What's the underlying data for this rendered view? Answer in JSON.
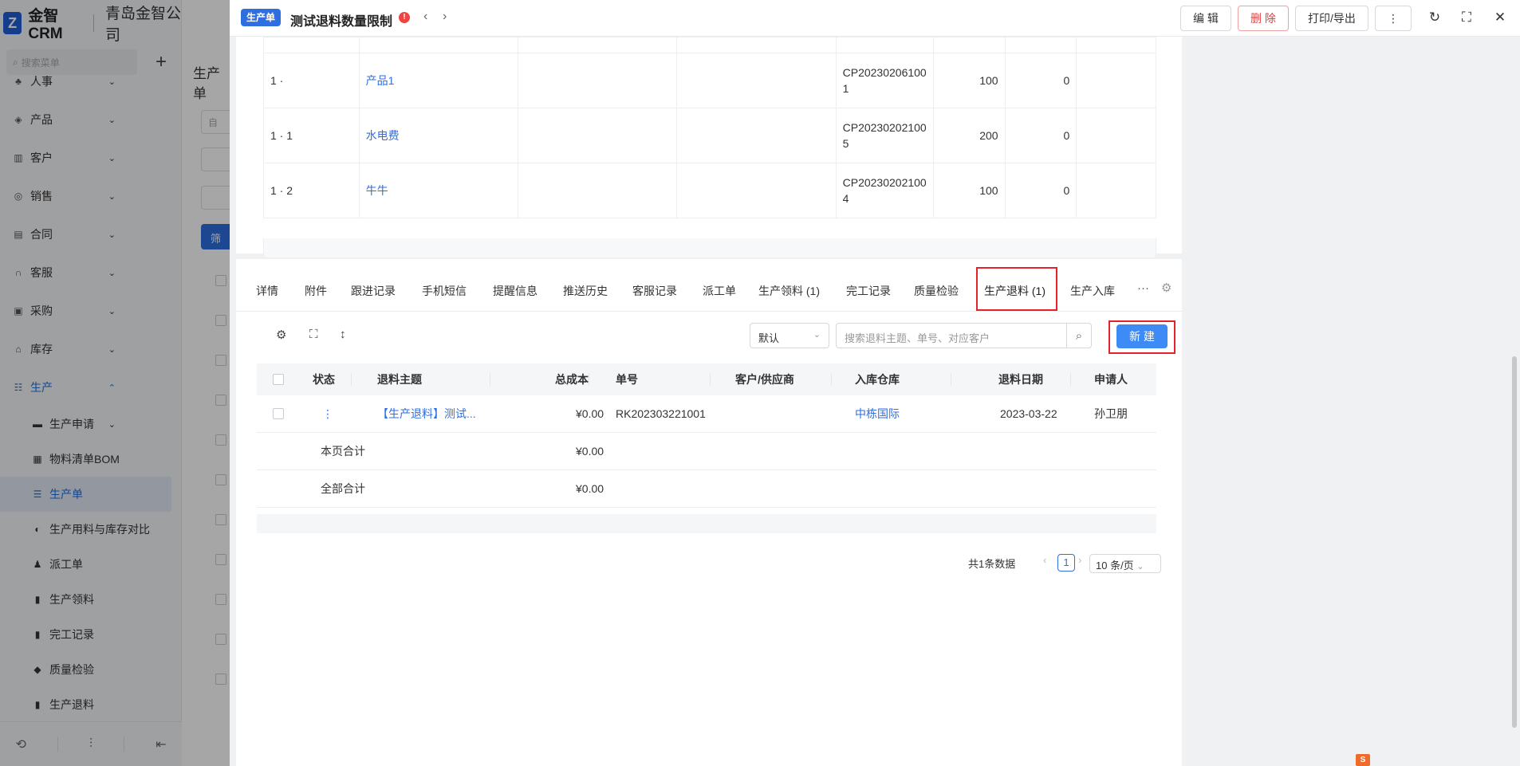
{
  "sidebar": {
    "logo_text": "金智CRM",
    "company": "青岛金智公司",
    "search_placeholder": "搜索菜单",
    "menu": [
      {
        "label": "人事",
        "icon": "users-icon"
      },
      {
        "label": "产品",
        "icon": "cube-icon"
      },
      {
        "label": "客户",
        "icon": "chart-icon"
      },
      {
        "label": "销售",
        "icon": "target-icon"
      },
      {
        "label": "合同",
        "icon": "document-icon"
      },
      {
        "label": "客服",
        "icon": "headset-icon"
      },
      {
        "label": "采购",
        "icon": "cart-icon"
      },
      {
        "label": "库存",
        "icon": "warehouse-icon"
      },
      {
        "label": "生产",
        "icon": "factory-icon"
      }
    ],
    "submenu": [
      {
        "label": "生产申请"
      },
      {
        "label": "物料清单BOM"
      },
      {
        "label": "生产单"
      },
      {
        "label": "生产用料与库存对比"
      },
      {
        "label": "派工单"
      },
      {
        "label": "生产领料"
      },
      {
        "label": "完工记录"
      },
      {
        "label": "质量检验"
      },
      {
        "label": "生产退料"
      }
    ]
  },
  "background": {
    "page_title": "生产单",
    "search_stub": "自",
    "filter_label": "筛"
  },
  "header": {
    "tag": "生产单",
    "title": "测试退料数量限制",
    "warn": "!",
    "buttons": {
      "edit": "编 辑",
      "delete": "删 除",
      "print": "打印/导出",
      "more": "⋮"
    }
  },
  "top_table": {
    "rows": [
      {
        "idx": "1 ·",
        "name": "产品1",
        "code_a": "CP20230206100",
        "code_b": "1",
        "qty": "100",
        "done": "0"
      },
      {
        "idx": "1 · 1",
        "name": "水电费",
        "code_a": "CP20230202100",
        "code_b": "5",
        "qty": "200",
        "done": "0"
      },
      {
        "idx": "1 · 2",
        "name": "牛牛",
        "code_a": "CP20230202100",
        "code_b": "4",
        "qty": "100",
        "done": "0"
      }
    ]
  },
  "tabs": [
    {
      "label": "详情"
    },
    {
      "label": "附件"
    },
    {
      "label": "跟进记录"
    },
    {
      "label": "手机短信"
    },
    {
      "label": "提醒信息"
    },
    {
      "label": "推送历史"
    },
    {
      "label": "客服记录"
    },
    {
      "label": "派工单"
    },
    {
      "label": "生产领料 (1)"
    },
    {
      "label": "完工记录"
    },
    {
      "label": "质量检验"
    },
    {
      "label": "生产退料 (1)"
    },
    {
      "label": "生产入库"
    }
  ],
  "tab_more": "···",
  "toolbar": {
    "select_value": "默认",
    "search_placeholder": "搜索退料主题、单号、对应客户",
    "new_label": "新 建"
  },
  "list": {
    "columns": {
      "status": "状态",
      "subject": "退料主题",
      "cost": "总成本",
      "number": "单号",
      "partner": "客户/供应商",
      "warehouse": "入库仓库",
      "date": "退料日期",
      "applicant": "申请人"
    },
    "row": {
      "status": "⋮",
      "subject": "【生产退料】测试...",
      "cost": "¥0.00",
      "number": "RK202303221001",
      "partner": "",
      "warehouse": "中栋国际",
      "date": "2023-03-22",
      "applicant": "孙卫朋"
    },
    "page_total_label": "本页合计",
    "page_total": "¥0.00",
    "all_total_label": "全部合计",
    "all_total": "¥0.00"
  },
  "pagination": {
    "summary": "共1条数据",
    "current": "1",
    "page_size": "10 条/页"
  },
  "colors": {
    "primary": "#2f6ee0",
    "new_button": "#3e8bf5",
    "highlight": "#e3222b",
    "danger": "#e04040"
  }
}
